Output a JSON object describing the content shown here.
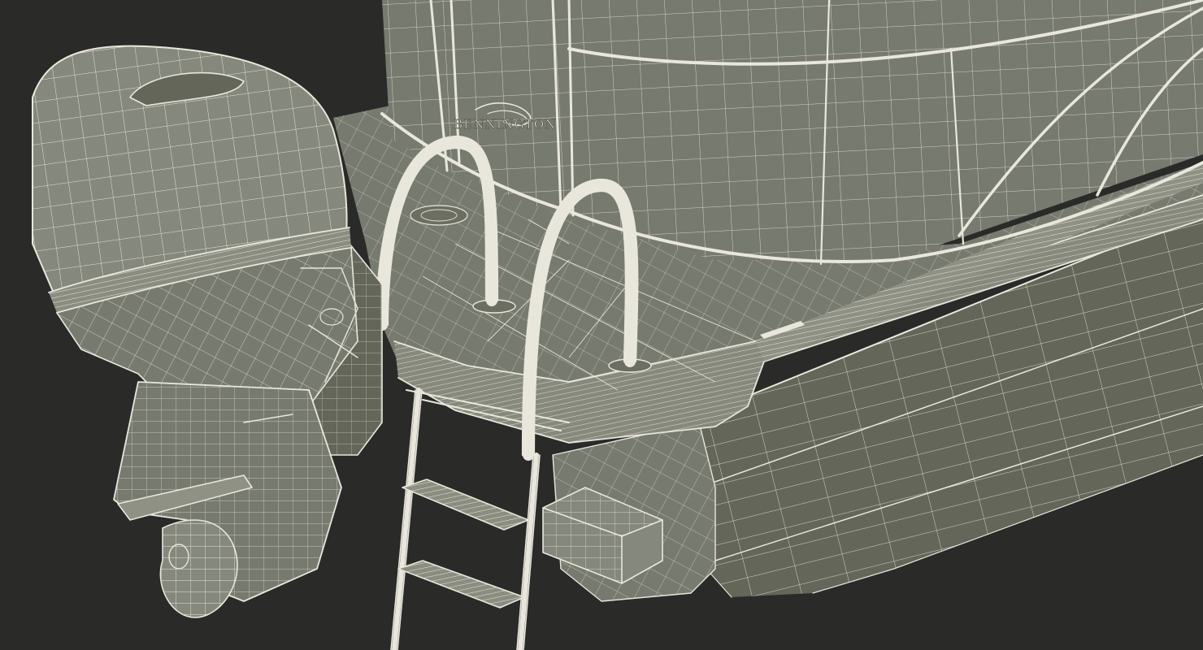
{
  "render": {
    "background_color": "#2a2a29",
    "surface_color": "#777a6f",
    "surface_dark_color": "#646659",
    "surface_light_color": "#85887c",
    "wire_color": "#e9e7dc"
  },
  "model": {
    "brand_label": "BENNINGTON"
  }
}
